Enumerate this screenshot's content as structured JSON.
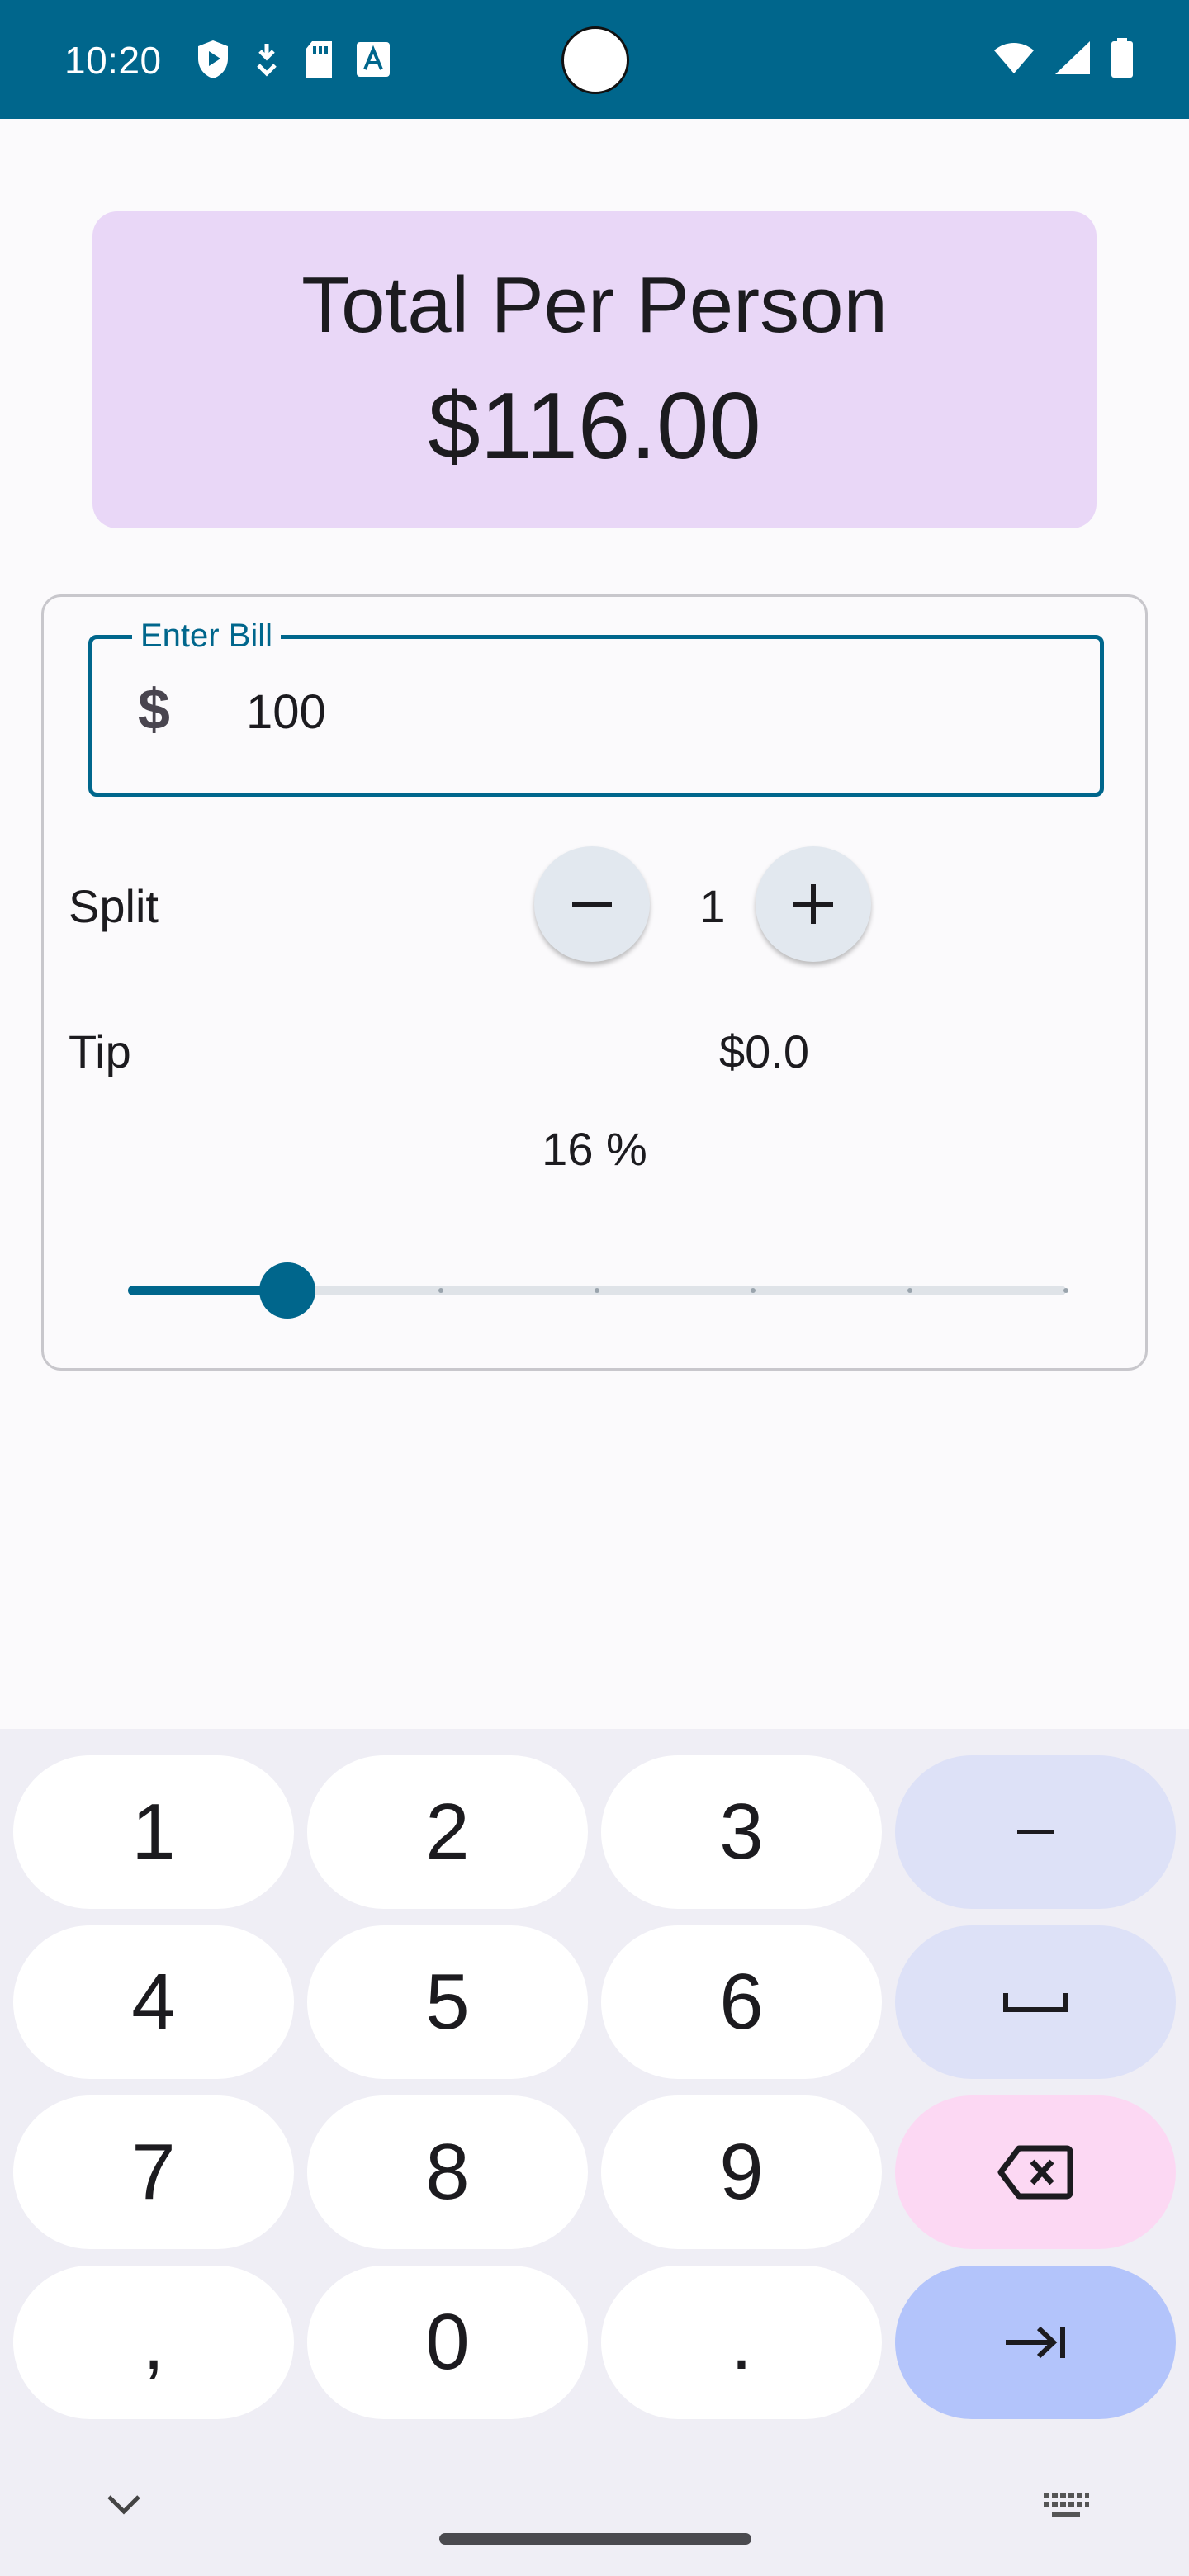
{
  "status_bar": {
    "time": "10:20",
    "icons_left": [
      "shield-play-icon",
      "download-icon",
      "sd-card-icon",
      "font-a-icon"
    ],
    "icons_right": [
      "wifi-icon",
      "signal-icon",
      "battery-icon"
    ],
    "bg_color": "#00668c"
  },
  "total_card": {
    "title": "Total Per Person",
    "amount": "$116.00",
    "bg_color": "#e9d7f7"
  },
  "bill_input": {
    "label": "Enter Bill",
    "prefix_icon": "dollar-icon",
    "value": "100",
    "accent_color": "#00668c"
  },
  "split": {
    "label": "Split",
    "count": "1",
    "decrement_icon": "minus-icon",
    "increment_icon": "plus-icon"
  },
  "tip": {
    "label": "Tip",
    "amount": "$0.0",
    "percent_label": "16 %",
    "slider": {
      "value": 0.17,
      "steps": 6
    }
  },
  "keyboard": {
    "keys": [
      {
        "label": "1",
        "kind": "digit"
      },
      {
        "label": "2",
        "kind": "digit"
      },
      {
        "label": "3",
        "kind": "digit"
      },
      {
        "label": "–",
        "kind": "function"
      },
      {
        "label": "4",
        "kind": "digit"
      },
      {
        "label": "5",
        "kind": "digit"
      },
      {
        "label": "6",
        "kind": "digit"
      },
      {
        "label": "␣",
        "kind": "function"
      },
      {
        "label": "7",
        "kind": "digit"
      },
      {
        "label": "8",
        "kind": "digit"
      },
      {
        "label": "9",
        "kind": "digit"
      },
      {
        "label": "",
        "kind": "delete",
        "icon": "backspace-icon"
      },
      {
        "label": ",",
        "kind": "digit"
      },
      {
        "label": "0",
        "kind": "digit"
      },
      {
        "label": ".",
        "kind": "digit"
      },
      {
        "label": "",
        "kind": "next",
        "icon": "tab-next-icon"
      }
    ],
    "collapse_icon": "chevron-down-icon",
    "switch_icon": "keyboard-icon"
  }
}
